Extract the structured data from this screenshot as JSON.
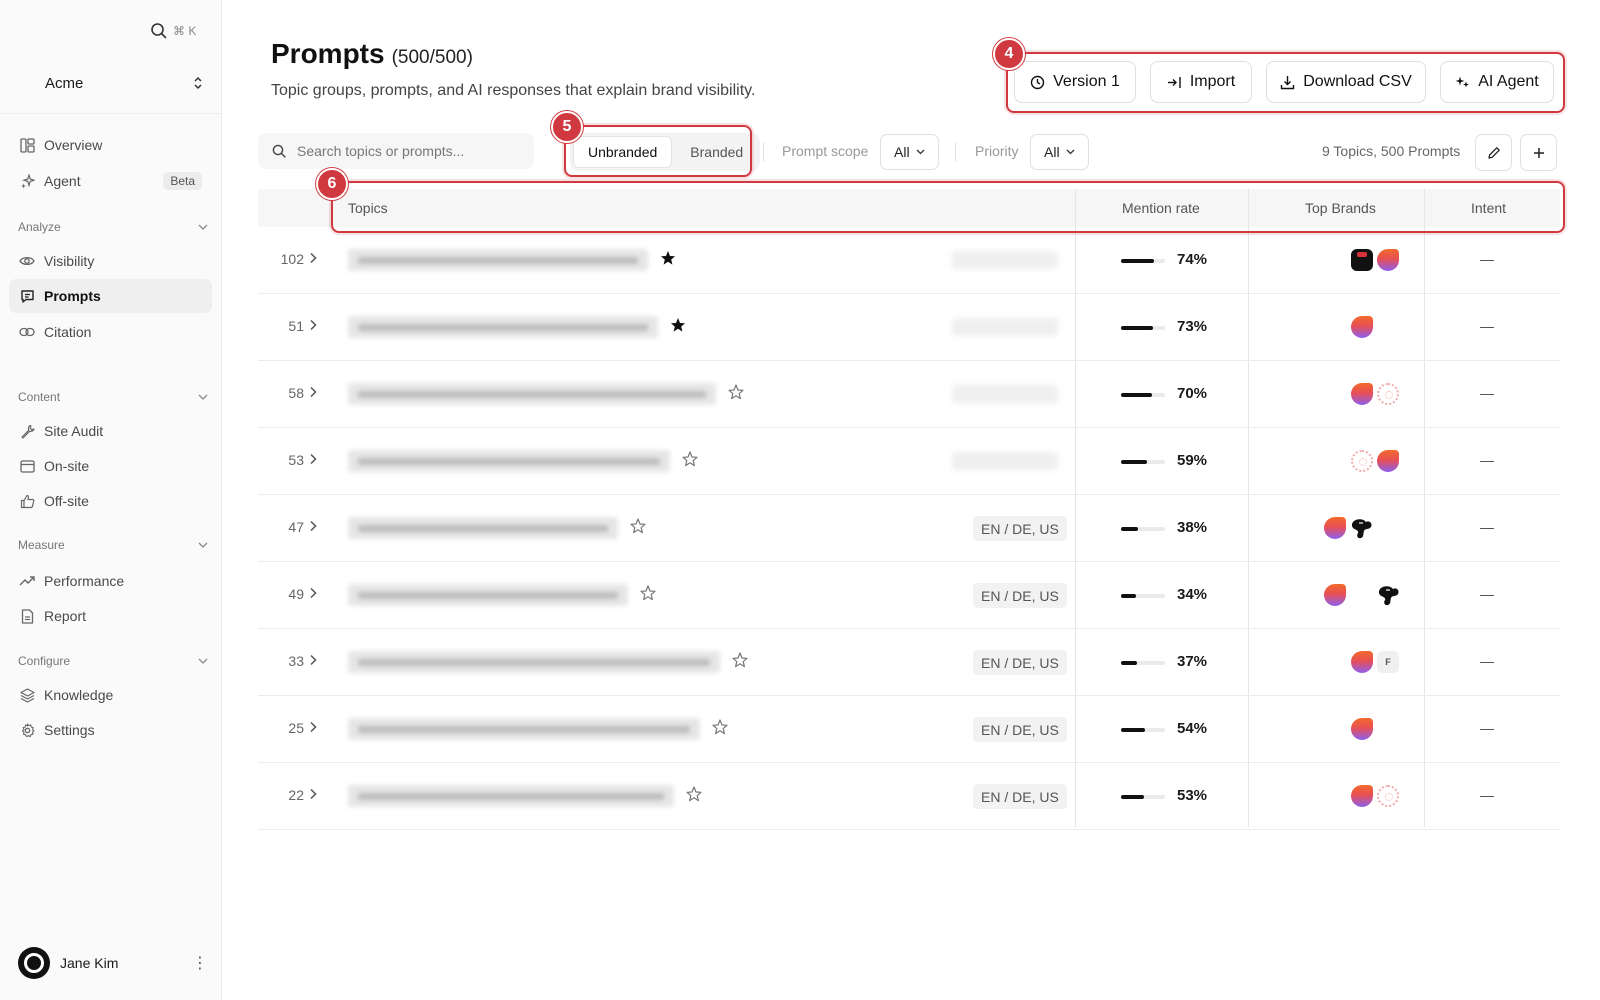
{
  "sidebar": {
    "search_shortcut": "⌘ K",
    "workspace": "Acme",
    "items_top": [
      {
        "label": "Overview",
        "icon": "overview-icon"
      },
      {
        "label": "Agent",
        "icon": "sparkle-icon",
        "badge": "Beta"
      }
    ],
    "sections": [
      {
        "title": "Analyze",
        "items": [
          {
            "label": "Visibility",
            "icon": "eye-icon"
          },
          {
            "label": "Prompts",
            "icon": "chat-icon",
            "active": true
          },
          {
            "label": "Citation",
            "icon": "link-icon"
          }
        ]
      },
      {
        "title": "Content",
        "items": [
          {
            "label": "Site Audit",
            "icon": "wrench-icon"
          },
          {
            "label": "On-site",
            "icon": "browser-icon"
          },
          {
            "label": "Off-site",
            "icon": "thumbs-up-icon"
          }
        ]
      },
      {
        "title": "Measure",
        "items": [
          {
            "label": "Performance",
            "icon": "trend-icon"
          },
          {
            "label": "Report",
            "icon": "document-icon"
          }
        ]
      },
      {
        "title": "Configure",
        "items": [
          {
            "label": "Knowledge",
            "icon": "layers-icon"
          },
          {
            "label": "Settings",
            "icon": "gear-icon"
          }
        ]
      }
    ],
    "user": {
      "name": "Jane Kim"
    }
  },
  "header": {
    "title": "Prompts",
    "count": "(500/500)",
    "subtitle": "Topic groups, prompts, and AI responses that explain brand visibility.",
    "buttons": {
      "version": "Version 1",
      "import": "Import",
      "download": "Download CSV",
      "agent": "AI Agent"
    }
  },
  "toolbar": {
    "search_placeholder": "Search topics or prompts...",
    "segments": [
      "Unbranded",
      "Branded"
    ],
    "prompt_scope_label": "Prompt scope",
    "prompt_scope_value": "All",
    "priority_label": "Priority",
    "priority_value": "All",
    "summary": "9 Topics, 500 Prompts"
  },
  "table": {
    "columns": {
      "topics": "Topics",
      "mention_rate": "Mention rate",
      "top_brands": "Top Brands",
      "intent": "Intent"
    },
    "rows": [
      {
        "num": "102",
        "starred": true,
        "region": "",
        "mention": "74%",
        "mention_value": 0.74,
        "intent": "—",
        "brands": [
          "dark",
          "grad"
        ]
      },
      {
        "num": "51",
        "starred": true,
        "region": "",
        "mention": "73%",
        "mention_value": 0.73,
        "intent": "—",
        "brands": [
          "grad"
        ]
      },
      {
        "num": "58",
        "starred": false,
        "region": "",
        "mention": "70%",
        "mention_value": 0.7,
        "intent": "—",
        "brands": [
          "grad",
          "ring"
        ]
      },
      {
        "num": "53",
        "starred": false,
        "region": "",
        "mention": "59%",
        "mention_value": 0.59,
        "intent": "—",
        "brands": [
          "ring",
          "grad"
        ]
      },
      {
        "num": "47",
        "starred": false,
        "region": "EN / DE, US",
        "mention": "38%",
        "mention_value": 0.38,
        "intent": "—",
        "brands": [
          "grad",
          "blob"
        ]
      },
      {
        "num": "49",
        "starred": false,
        "region": "EN / DE, US",
        "mention": "34%",
        "mention_value": 0.34,
        "intent": "—",
        "brands": [
          "grad",
          "blob"
        ]
      },
      {
        "num": "33",
        "starred": false,
        "region": "EN / DE, US",
        "mention": "37%",
        "mention_value": 0.37,
        "intent": "—",
        "brands": [
          "grad",
          "f"
        ]
      },
      {
        "num": "25",
        "starred": false,
        "region": "EN / DE, US",
        "mention": "54%",
        "mention_value": 0.54,
        "intent": "—",
        "brands": [
          "grad"
        ]
      },
      {
        "num": "22",
        "starred": false,
        "region": "EN / DE, US",
        "mention": "53%",
        "mention_value": 0.53,
        "intent": "—",
        "brands": [
          "grad",
          "ring"
        ]
      }
    ]
  },
  "annotations": [
    "4",
    "5",
    "6"
  ],
  "colors": {
    "annotation": "#d0393f",
    "active_nav_bg": "#efefef",
    "bar": "#111111"
  }
}
